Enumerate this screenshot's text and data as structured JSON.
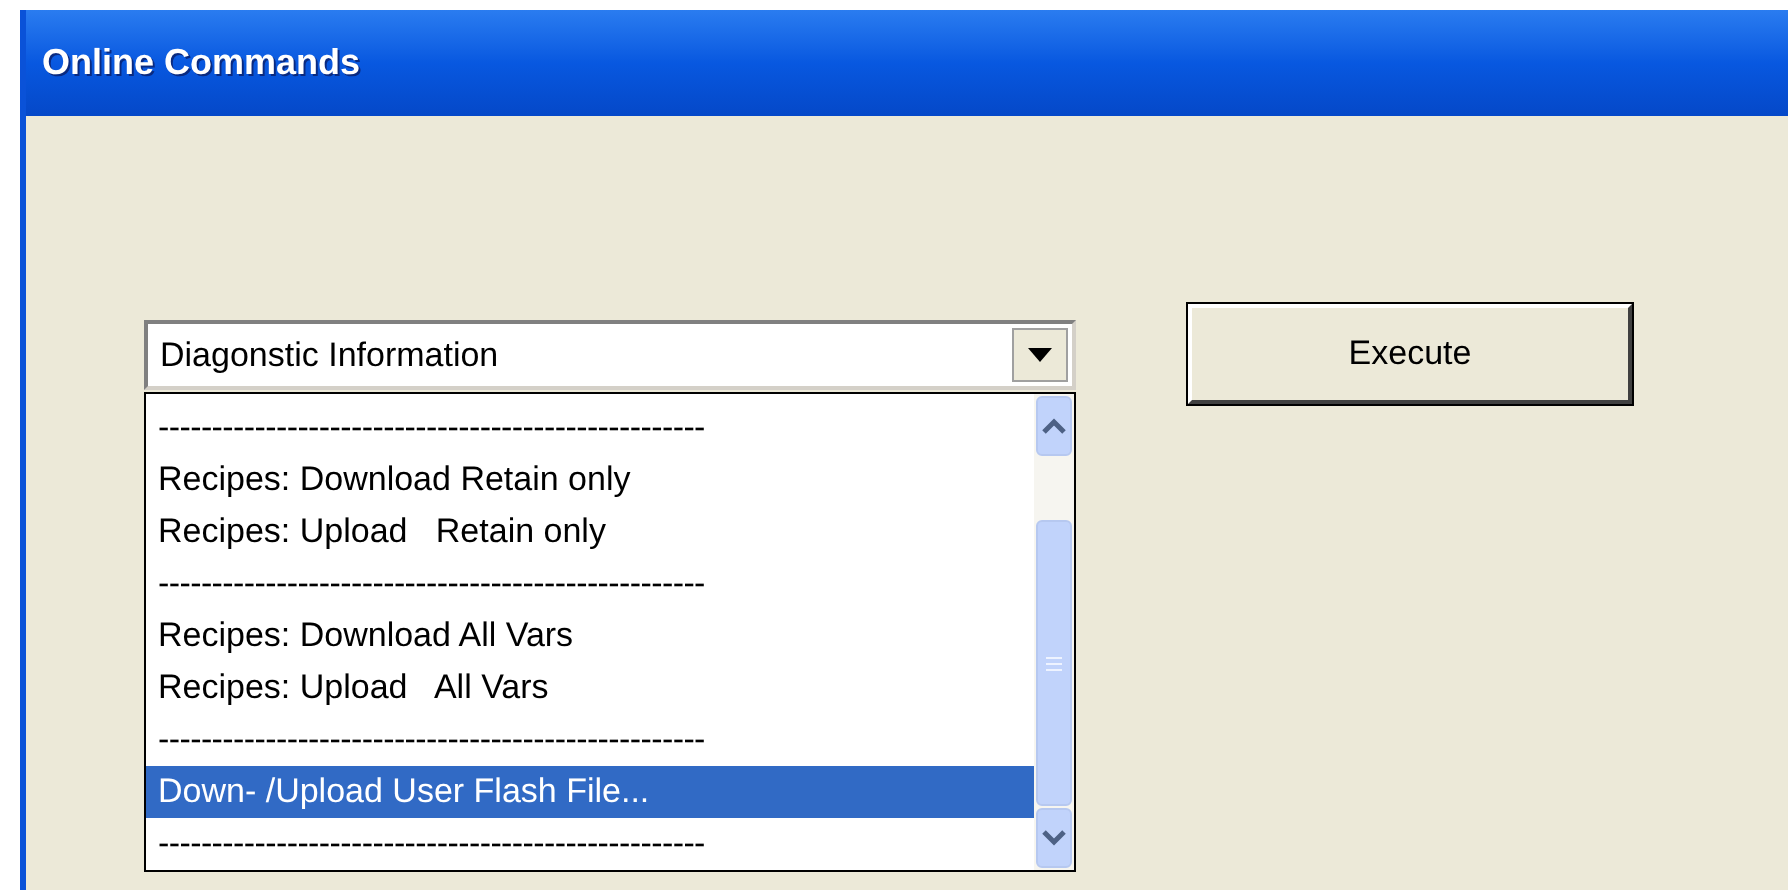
{
  "window": {
    "title": "Online Commands"
  },
  "combo": {
    "value": "Diagonstic Information"
  },
  "list": {
    "items": [
      {
        "kind": "separator",
        "text": "---------------------------------------------------"
      },
      {
        "kind": "item",
        "text": "Recipes: Download Retain only",
        "selected": false
      },
      {
        "kind": "item",
        "text": "Recipes: Upload   Retain only",
        "selected": false
      },
      {
        "kind": "separator",
        "text": "---------------------------------------------------"
      },
      {
        "kind": "item",
        "text": "Recipes: Download All Vars",
        "selected": false
      },
      {
        "kind": "item",
        "text": "Recipes: Upload   All Vars",
        "selected": false
      },
      {
        "kind": "separator",
        "text": "---------------------------------------------------"
      },
      {
        "kind": "item",
        "text": "Down- /Upload User Flash File...",
        "selected": true
      },
      {
        "kind": "separator",
        "text": "---------------------------------------------------"
      }
    ]
  },
  "buttons": [
    "Execute"
  ]
}
